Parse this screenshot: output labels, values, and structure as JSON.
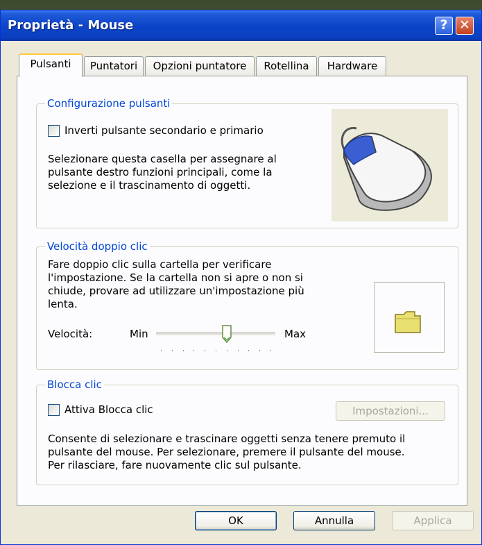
{
  "window": {
    "title": "Proprietà - Mouse",
    "help_glyph": "?",
    "close_glyph": "✕"
  },
  "tabs": [
    "Pulsanti",
    "Puntatori",
    "Opzioni puntatore",
    "Rotellina",
    "Hardware"
  ],
  "button_config": {
    "legend": "Configurazione pulsanti",
    "checkbox_label": "Inverti pulsante secondario e primario",
    "checked": false,
    "description": [
      "Selezionare questa casella per assegnare al",
      "pulsante destro funzioni principali, come la",
      "selezione e il trascinamento di oggetti."
    ]
  },
  "double_click": {
    "legend": "Velocità doppio clic",
    "description": [
      "Fare doppio clic sulla cartella per verificare",
      "l'impostazione. Se la cartella non si apre o non si",
      "chiude, provare ad utilizzare un'impostazione più",
      "lenta."
    ],
    "speed_label": "Velocità:",
    "min_label": "Min",
    "max_label": "Max",
    "slider_value": 0.6
  },
  "click_lock": {
    "legend": "Blocca clic",
    "checkbox_label": "Attiva Blocca clic",
    "checked": false,
    "settings_button": "Impostazioni...",
    "description": [
      "Consente di selezionare e trascinare oggetti senza tenere premuto il",
      "pulsante del mouse. Per selezionare, premere il pulsante del mouse.",
      "Per rilasciare, fare nuovamente clic sul pulsante."
    ]
  },
  "footer": {
    "ok": "OK",
    "cancel": "Annulla",
    "apply": "Applica"
  },
  "colors": {
    "title_bar": "#0a3fc0",
    "legend_text": "#0046d5",
    "tab_highlight": "#ffc83c",
    "folder": "#e8e070"
  }
}
